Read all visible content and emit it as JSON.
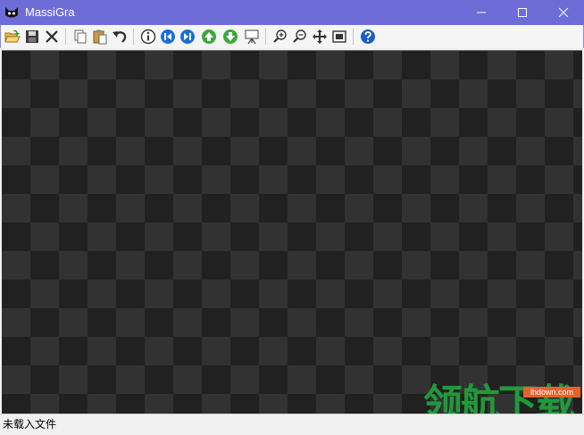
{
  "window": {
    "title": "MassiGra"
  },
  "toolbar": {
    "buttons": [
      {
        "name": "open",
        "icon": "open-folder-icon"
      },
      {
        "name": "save",
        "icon": "save-disk-icon"
      },
      {
        "name": "close",
        "icon": "close-x-icon"
      },
      {
        "name": "copy",
        "icon": "copy-icon"
      },
      {
        "name": "paste",
        "icon": "paste-icon"
      },
      {
        "name": "undo",
        "icon": "undo-icon"
      },
      {
        "name": "info",
        "icon": "info-icon"
      },
      {
        "name": "previous",
        "icon": "previous-blue-icon"
      },
      {
        "name": "next",
        "icon": "next-blue-icon"
      },
      {
        "name": "up",
        "icon": "up-green-icon"
      },
      {
        "name": "down",
        "icon": "down-green-icon"
      },
      {
        "name": "slideshow",
        "icon": "slideshow-icon"
      },
      {
        "name": "zoom-in",
        "icon": "zoom-in-icon"
      },
      {
        "name": "zoom-out",
        "icon": "zoom-out-icon"
      },
      {
        "name": "pan",
        "icon": "pan-icon"
      },
      {
        "name": "fit",
        "icon": "fit-window-icon"
      },
      {
        "name": "help",
        "icon": "help-icon"
      }
    ]
  },
  "status": {
    "text": "未载入文件"
  },
  "watermark": {
    "site": "lhdown.com",
    "text": "领航下载"
  },
  "colors": {
    "titlebar": "#6e6cd7",
    "checker_dark": "#212121",
    "checker_light": "#323232",
    "watermark_green": "#1f9a3a",
    "watermark_orange": "#e7622b"
  }
}
